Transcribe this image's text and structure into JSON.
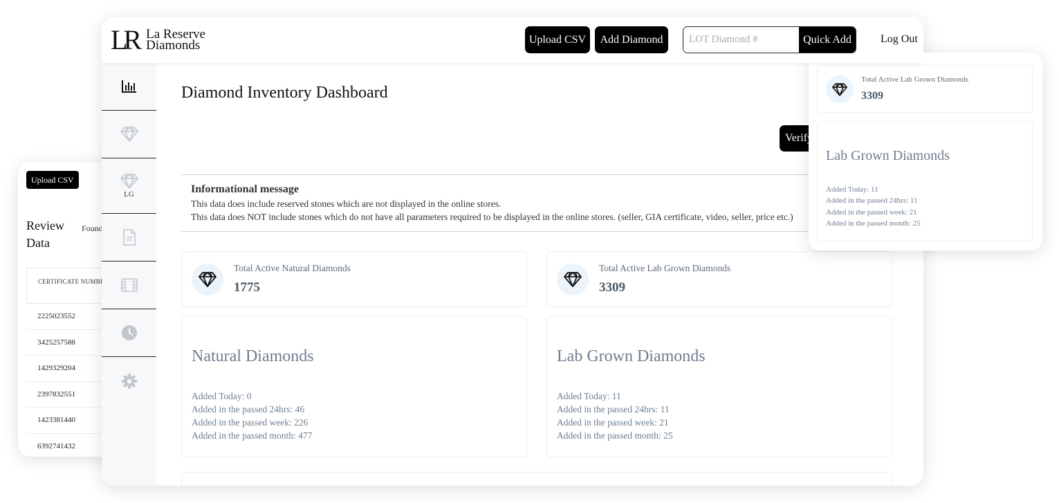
{
  "review": {
    "upload_label": "Upload CSV",
    "title": "Review Data",
    "found_text": "Found records",
    "column_header": "CERTIFICATE NUMBER",
    "rows": [
      "2225023552",
      "3425257588",
      "1429329204",
      "2397832551",
      "1423381440",
      "6392741432"
    ]
  },
  "header": {
    "logo_mark": "LR",
    "logo_line1": "La Reserve",
    "logo_line2": "Diamonds",
    "upload_label": "Upload CSV",
    "add_label": "Add Diamond",
    "lot_placeholder": "LOT Diamond #",
    "quick_add_label": "Quick Add",
    "logout_label": "Log Out"
  },
  "sidebar": {
    "items": [
      {
        "icon": "bar-chart-icon"
      },
      {
        "icon": "diamond-icon"
      },
      {
        "icon": "lab-grown-diamond-icon",
        "label": "LG"
      },
      {
        "icon": "document-icon"
      },
      {
        "icon": "film-icon"
      },
      {
        "icon": "clock-icon"
      },
      {
        "icon": "gear-icon"
      }
    ]
  },
  "main": {
    "title": "Diamond Inventory Dashboard",
    "verify_label": "Verify",
    "info": {
      "title": "Informational message",
      "line1": "This data does include reserved stones which are not displayed in the online stores.",
      "line2": "This data does NOT include stones which do not have all parameters required to be displayed in the online stores. (seller, GIA certificate, video, seller, price etc.)"
    },
    "natural_stat": {
      "label": "Total Active Natural Diamonds",
      "value": "1775"
    },
    "lab_stat": {
      "label": "Total Active Lab Grown Diamonds",
      "value": "3309"
    },
    "natural_summary": {
      "title": "Natural Diamonds",
      "today": "Added Today: 0",
      "day": "Added in the passed 24hrs: 46",
      "week": "Added in the passed week: 226",
      "month": "Added in the passed month: 477"
    },
    "lab_summary": {
      "title": "Lab Grown Diamonds",
      "today": "Added Today: 11",
      "day": "Added in the passed 24hrs: 11",
      "week": "Added in the passed week: 21",
      "month": "Added in the passed month: 25"
    }
  },
  "right_panel": {
    "stat_label": "Total Active Lab Grown Diamonds",
    "stat_value": "3309",
    "title": "Lab Grown Diamonds",
    "today": "Added Today: 11",
    "day": "Added in the passed 24hrs: 11",
    "week": "Added in the passed week: 21",
    "month": "Added in the passed month: 25"
  },
  "colors": {
    "accent_black": "#000000",
    "muted_text": "#6e7e90",
    "icon_circle": "#ebf4fa",
    "sidebar_bg": "#f7f8fa"
  }
}
